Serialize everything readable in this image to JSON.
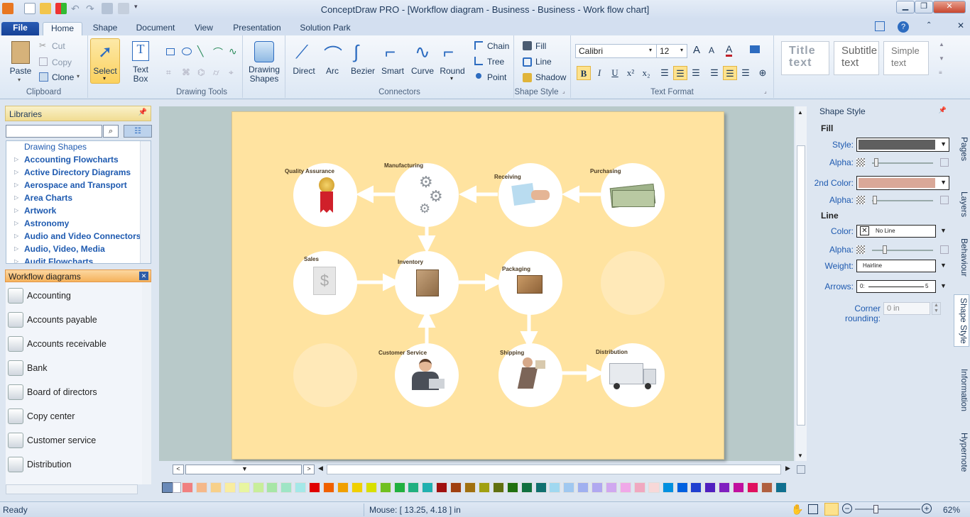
{
  "window": {
    "title": "ConceptDraw PRO - [Workflow diagram - Business - Business - Work flow chart]"
  },
  "tabs": [
    "File",
    "Home",
    "Shape",
    "Document",
    "View",
    "Presentation",
    "Solution Park"
  ],
  "ribbon": {
    "clipboard": {
      "paste": "Paste",
      "cut": "Cut",
      "copy": "Copy",
      "clone": "Clone",
      "label": "Clipboard"
    },
    "select": "Select",
    "textbox": [
      "Text",
      "Box"
    ],
    "drawing_tools_label": "Drawing Tools",
    "drawing_shapes": [
      "Drawing",
      "Shapes"
    ],
    "connectors": {
      "items": [
        "Direct",
        "Arc",
        "Bezier",
        "Smart",
        "Curve",
        "Round"
      ],
      "chain": "Chain",
      "tree": "Tree",
      "point": "Point",
      "label": "Connectors"
    },
    "shape_style": {
      "fill": "Fill",
      "line": "Line",
      "shadow": "Shadow",
      "label": "Shape Style"
    },
    "text_format": {
      "font": "Calibri",
      "size": "12",
      "label": "Text Format"
    },
    "styles": {
      "title": "Title text",
      "subtitle": "Subtitle text",
      "simple": "Simple text"
    }
  },
  "libraries": {
    "header": "Libraries",
    "search_placeholder": "",
    "tree": [
      "Drawing Shapes",
      "Accounting Flowcharts",
      "Active Directory Diagrams",
      "Aerospace and Transport",
      "Area Charts",
      "Artwork",
      "Astronomy",
      "Audio and Video Connectors",
      "Audio, Video, Media",
      "Audit Flowcharts"
    ],
    "open_lib": "Workflow diagrams",
    "shapes": [
      "Accounting",
      "Accounts payable",
      "Accounts receivable",
      "Bank",
      "Board of directors",
      "Copy center",
      "Customer service",
      "Distribution"
    ]
  },
  "diagram": {
    "nodes": {
      "quality": "Quality Assurance",
      "manufacturing": "Manufacturing",
      "receiving": "Receiving",
      "purchasing": "Purchasing",
      "sales": "Sales",
      "inventory": "Inventory",
      "packaging": "Packaging",
      "customer": "Customer Service",
      "shipping": "Shipping",
      "distribution": "Distribution"
    }
  },
  "shape_style_panel": {
    "header": "Shape Style",
    "fill": "Fill",
    "style": "Style:",
    "alpha": "Alpha:",
    "second_color": "2nd Color:",
    "line": "Line",
    "color": "Color:",
    "color_value": "No Line",
    "weight": "Weight:",
    "weight_value": "Hairline",
    "arrows": "Arrows:",
    "arrow_start": "0:",
    "arrow_end": "5",
    "corner": "Corner rounding:",
    "corner_value": "0 in",
    "fill_color": "#5f5f5f",
    "second_fill_color": "#d9a898"
  },
  "vertical_tabs": [
    "Pages",
    "Layers",
    "Behaviour",
    "Shape Style",
    "Information",
    "Hypernote"
  ],
  "status": {
    "ready": "Ready",
    "mouse": "Mouse: [ 13.25, 4.18 ] in",
    "zoom": "62%"
  },
  "palette": [
    "#f08080",
    "#f5b88a",
    "#f7d08a",
    "#f9eda0",
    "#e8f5a0",
    "#c8ee9a",
    "#a7e6a7",
    "#9fe5c5",
    "#a4e8e8",
    "#e00000",
    "#f06000",
    "#f0a000",
    "#f0d000",
    "#d8e000",
    "#70c020",
    "#20b040",
    "#20b080",
    "#20b0b0",
    "#a01010",
    "#a04010",
    "#a07010",
    "#a0a010",
    "#607010",
    "#207010",
    "#107040",
    "#107070",
    "#a0d8f0",
    "#a0c8f0",
    "#a0b0f0",
    "#b0a8f0",
    "#d0a8f0",
    "#f0a8e8",
    "#f0a8c0",
    "#f8d8d8",
    "#0090e0",
    "#0060e0",
    "#2040d0",
    "#5020c0",
    "#8020c0",
    "#c010a0",
    "#e01060",
    "#b06040",
    "#107090"
  ]
}
